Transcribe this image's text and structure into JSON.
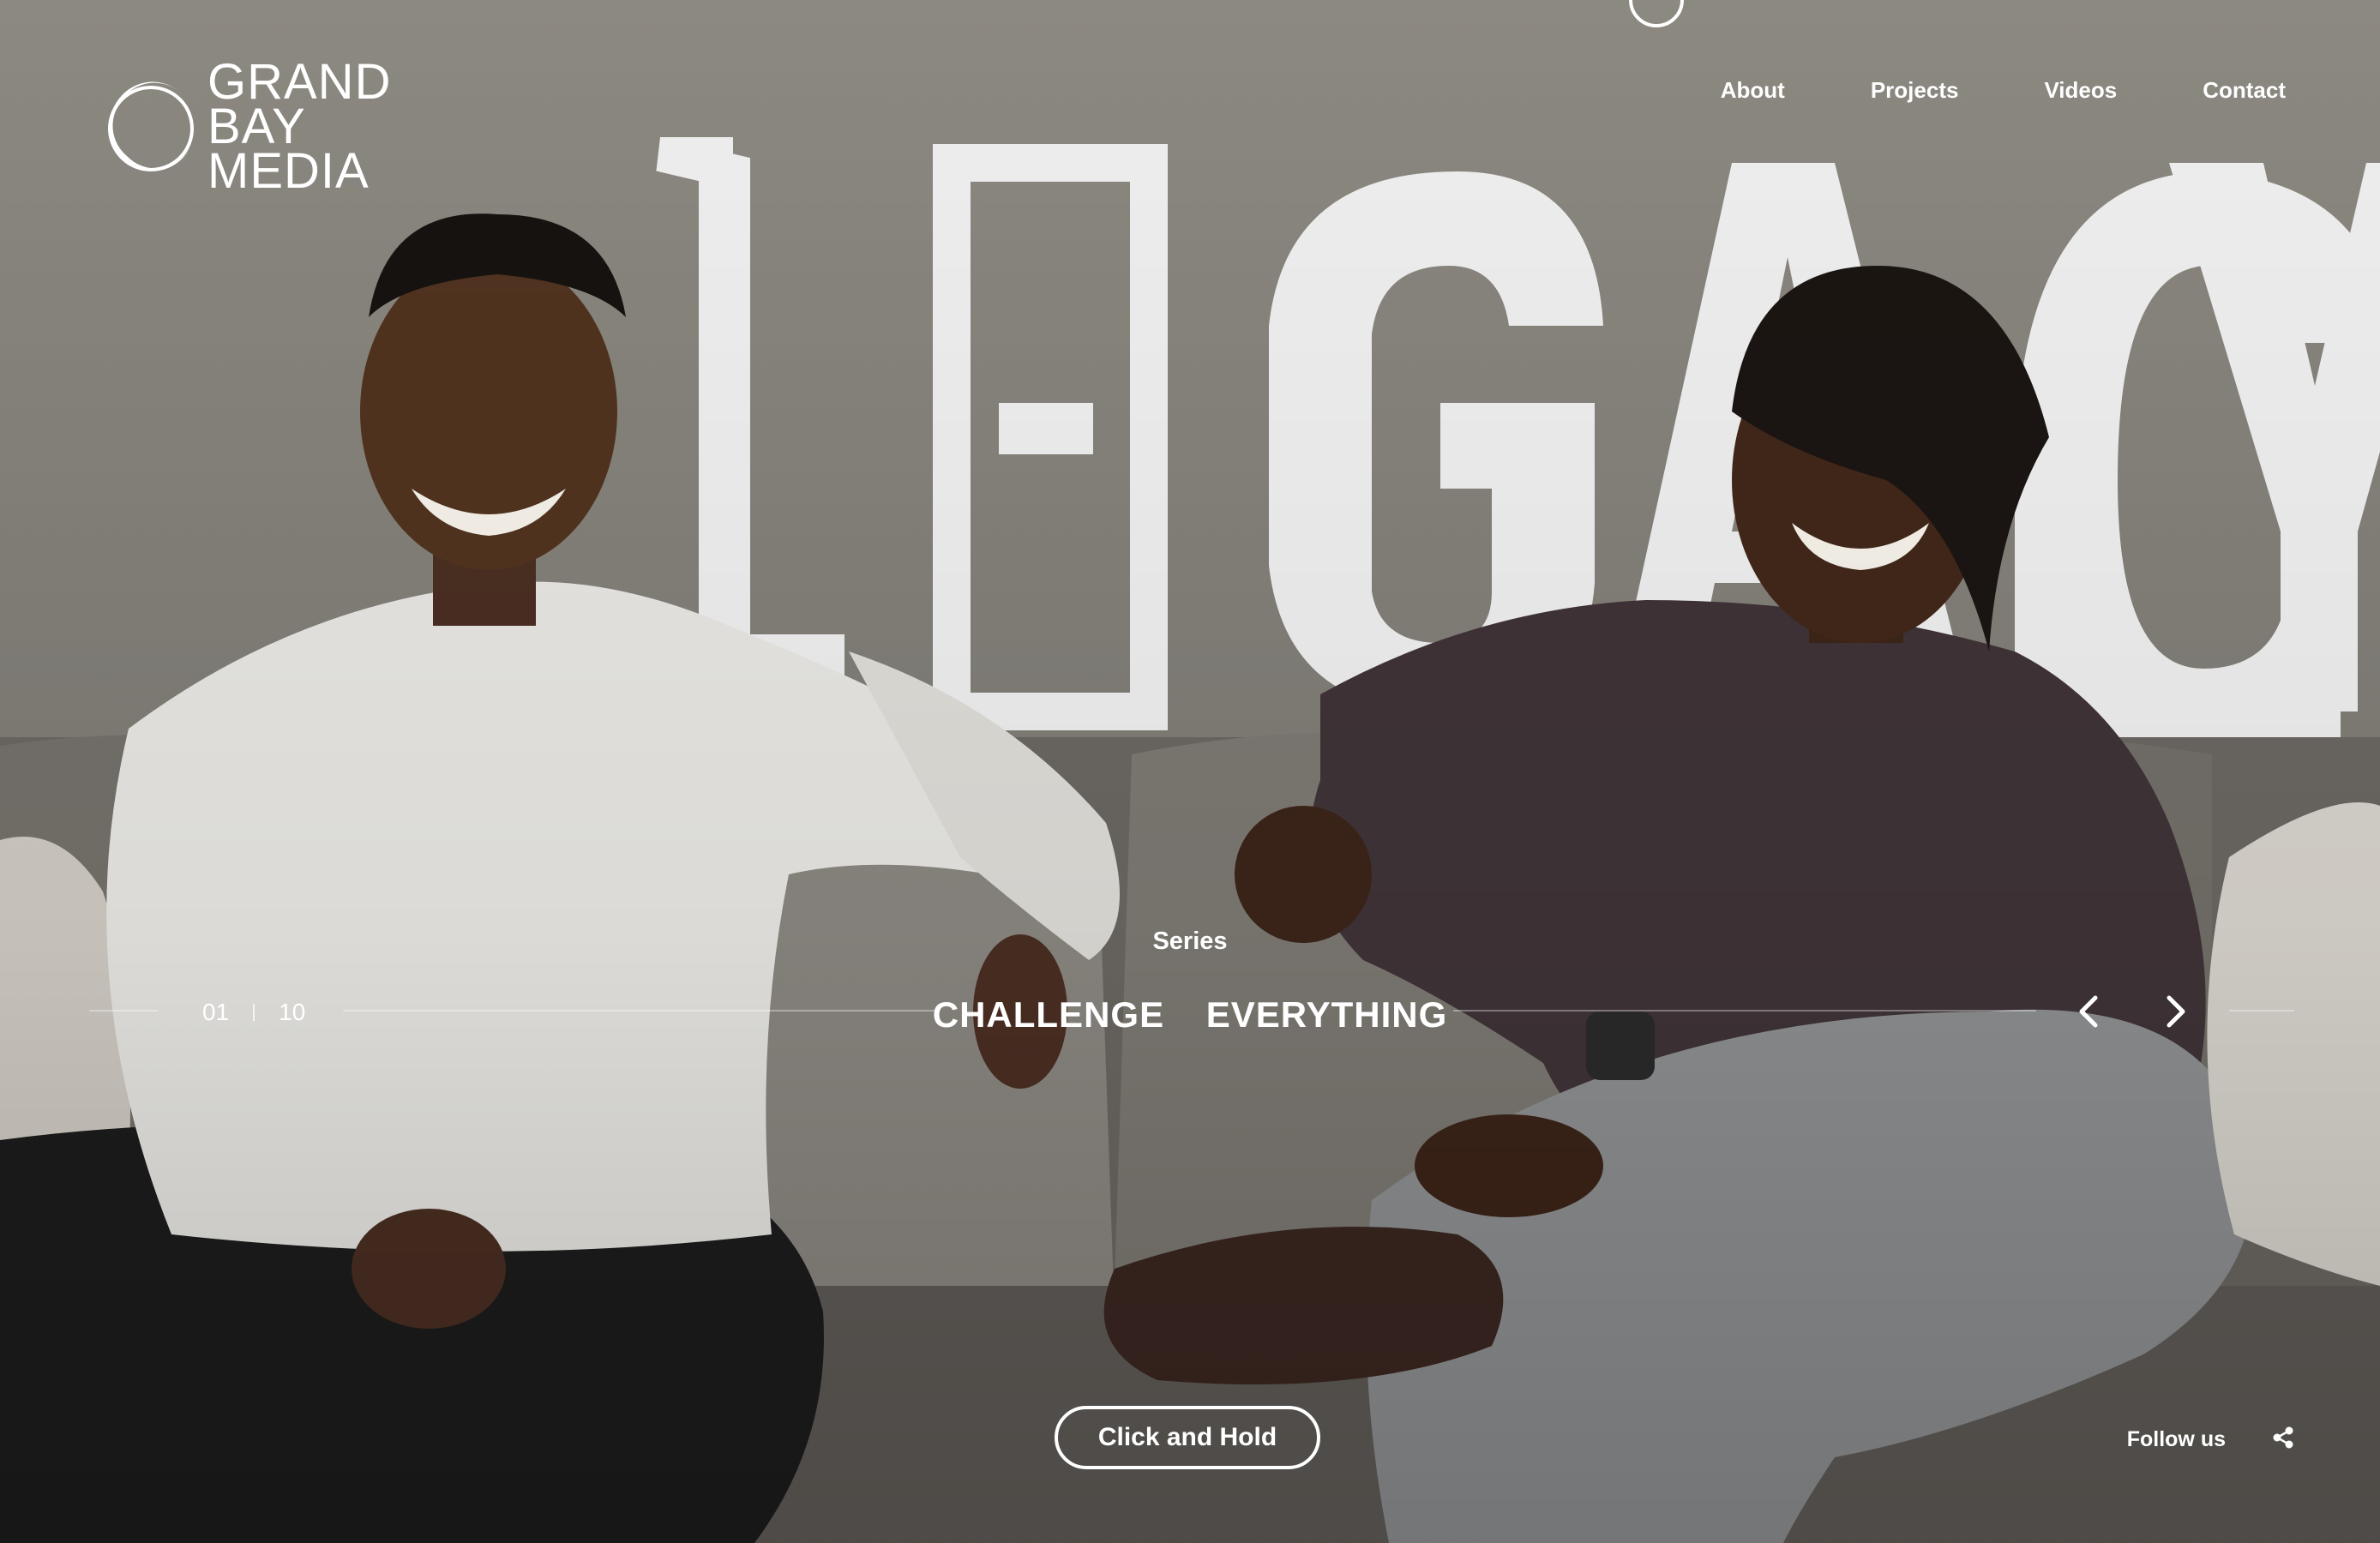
{
  "brand": {
    "lines": [
      "GRAND",
      "BAY",
      "MEDIA"
    ]
  },
  "nav": [
    {
      "label": "About"
    },
    {
      "label": "Projects"
    },
    {
      "label": "Videos"
    },
    {
      "label": "Contact"
    }
  ],
  "slide": {
    "category": "Series",
    "title_words": [
      "CHALLENGE",
      "EVERYTHING"
    ],
    "current": "01",
    "total": "10",
    "background_text": "LEGACY"
  },
  "cta": {
    "label": "Click and Hold"
  },
  "social": {
    "label": "Follow us"
  },
  "icons": {
    "logo_mark": "crescent-ring-icon",
    "prev": "chevron-left-icon",
    "next": "chevron-right-icon",
    "share": "share-icon",
    "scroll_indicator": "circle-icon"
  },
  "colors": {
    "text": "#ffffff",
    "background": "#8a8780",
    "sofa": "#6f6a64"
  }
}
